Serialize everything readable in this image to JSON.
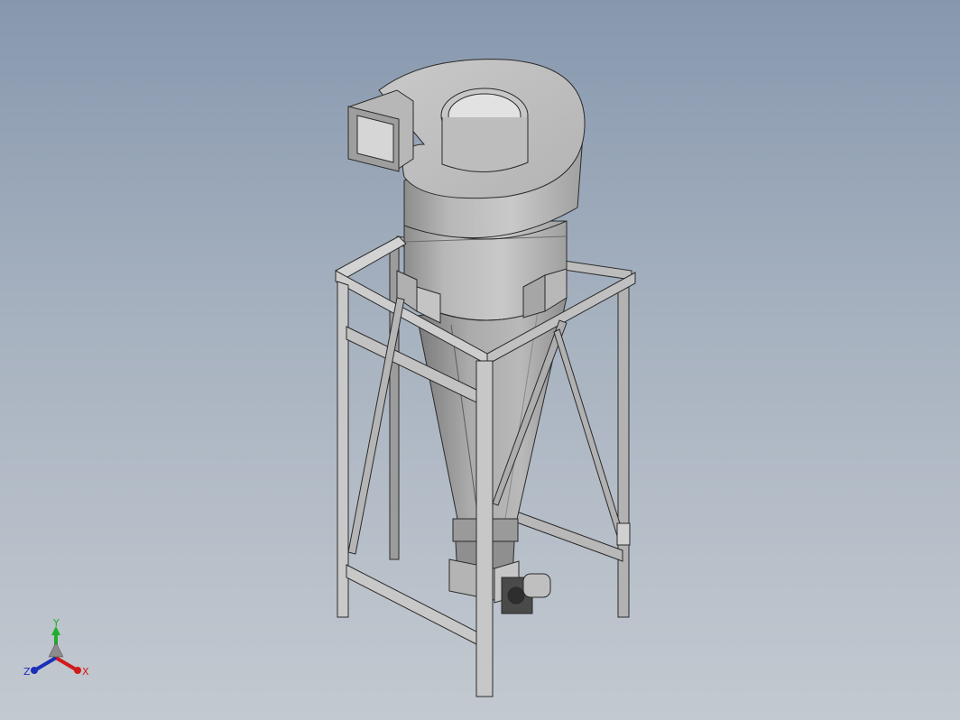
{
  "triad": {
    "x_label": "X",
    "y_label": "Y",
    "z_label": "Z",
    "x_color": "#d21a1a",
    "y_color": "#1fae2c",
    "z_color": "#1c2fb8"
  },
  "colors": {
    "background_top": "#8798ae",
    "background_bottom": "#c3c9d0",
    "steel_light": "#c4c4c4",
    "steel_mid": "#a9a9a9",
    "steel_dark": "#7c7c7c",
    "edge": "#2a2a2a"
  },
  "model": {
    "name_icon": "cyclone-separator-icon"
  }
}
